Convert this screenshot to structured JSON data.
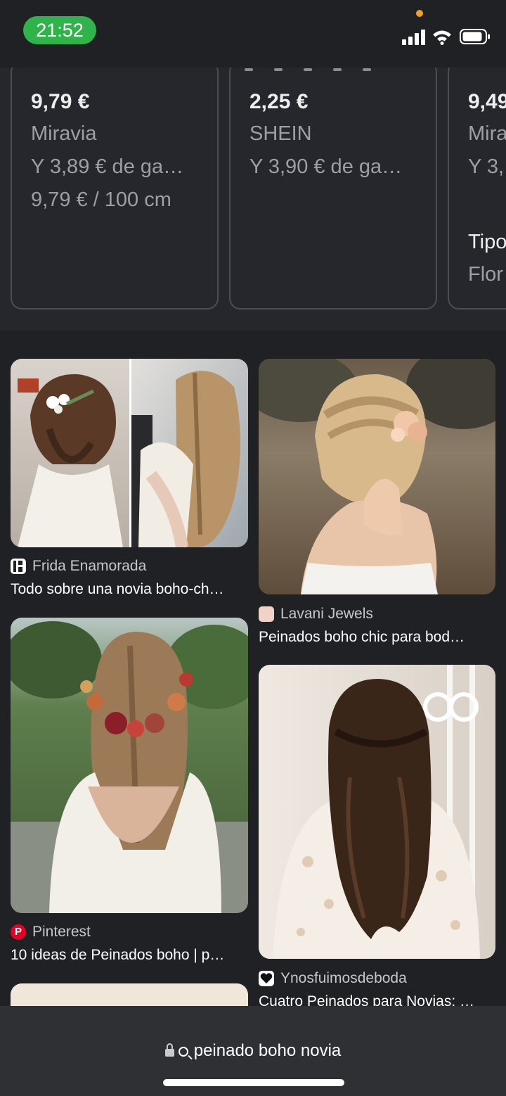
{
  "status_bar": {
    "time": "21:52",
    "icons": [
      "cellular-signal-icon",
      "wifi-icon",
      "battery-icon"
    ],
    "time_pill_color": "#2fb34a",
    "privacy_dot_color": "#f0a030"
  },
  "shopping": {
    "cards": [
      {
        "price": "9,79 €",
        "store": "Miravia",
        "shipping": "Y 3,89 € de ga…",
        "unit_price": "9,79 € / 100 cm"
      },
      {
        "price": "2,25 €",
        "store": "SHEIN",
        "shipping": "Y 3,90 € de ga…"
      },
      {
        "price": "9,49",
        "store": "Mira",
        "shipping": "Y 3,",
        "attr_label": "Tipo",
        "attr_value": "Flor"
      }
    ]
  },
  "results": [
    {
      "source": "Frida Enamorada",
      "title": "Todo sobre una novia boho-ch…",
      "favicon": "frida-favicon-icon"
    },
    {
      "source": "Lavani Jewels",
      "title": "Peinados boho chic para bod…",
      "favicon": "lavani-favicon-icon"
    },
    {
      "source": "Pinterest",
      "title": "10 ideas de Peinados boho | p…",
      "favicon": "pinterest-icon"
    },
    {
      "source": "Ynosfuimosdeboda",
      "title": "Cuatro Peinados para Novias: …",
      "favicon": "heart-favicon-icon"
    }
  ],
  "url_bar": {
    "query": "peinado boho novia",
    "icons": [
      "lock-icon",
      "search-icon"
    ]
  },
  "colors": {
    "background": "#202124",
    "card_border": "#4a4d52",
    "muted_text": "#9aa0a6",
    "url_bar": "#2f3034"
  }
}
